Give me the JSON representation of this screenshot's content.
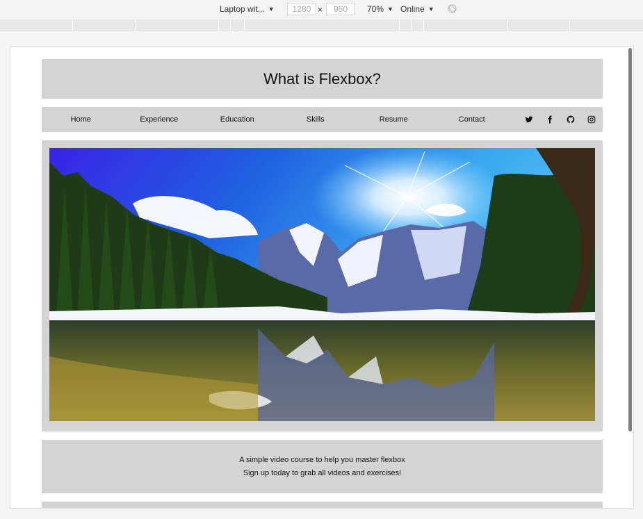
{
  "devtools": {
    "device": "Laptop wit...",
    "width": "1280",
    "height": "950",
    "times": "×",
    "zoom": "70%",
    "network": "Online",
    "dropdown_glyph": "▼"
  },
  "page": {
    "title": "What is Flexbox?",
    "nav": {
      "links": [
        "Home",
        "Experience",
        "Education",
        "Skills",
        "Resume",
        "Contact"
      ],
      "icons": [
        "twitter-icon",
        "facebook-icon",
        "github-icon",
        "instagram-icon"
      ]
    },
    "promo": {
      "line1": "A simple video course to help you master flexbox",
      "line2": "Sign up today to grab all videos and exercises!"
    }
  },
  "colors": {
    "panel": "#d4d4d4",
    "page_bg": "#ffffff",
    "chrome_bg": "#f3f3f3"
  }
}
